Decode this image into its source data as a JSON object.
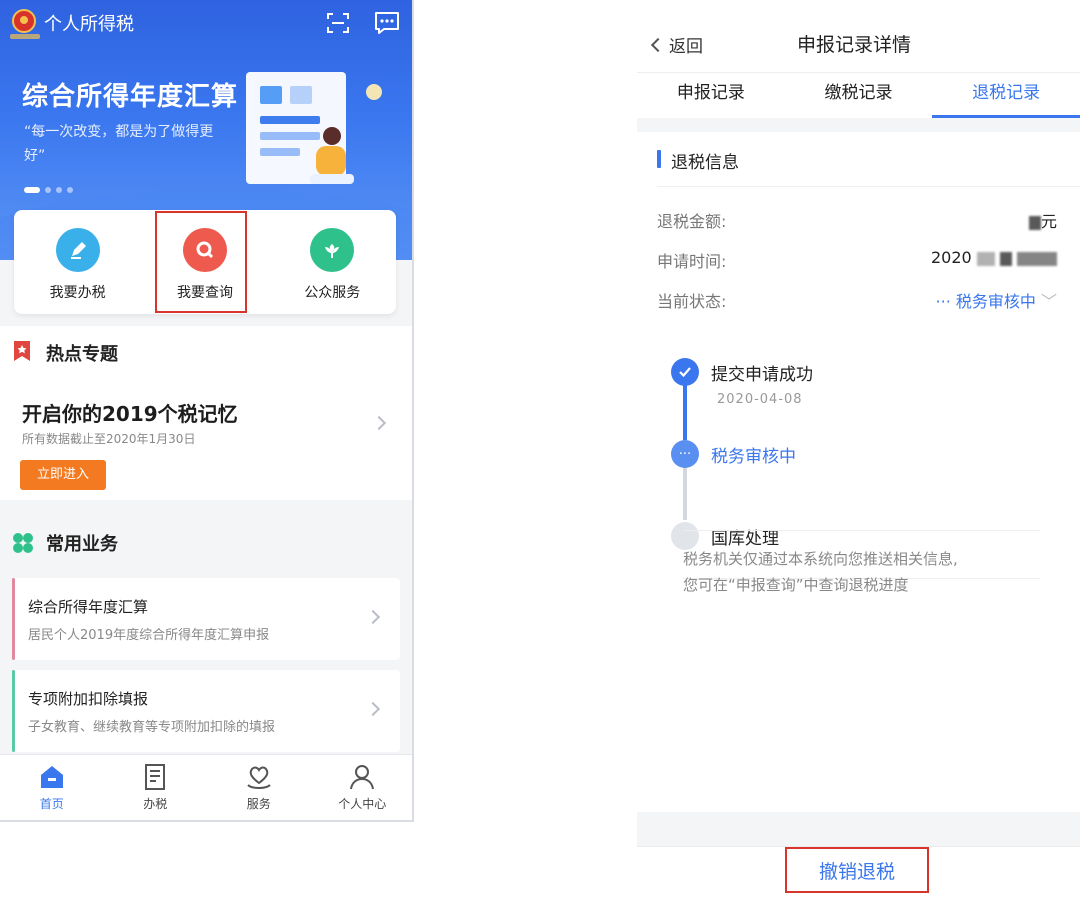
{
  "left": {
    "app_title": "个人所得税",
    "banner": {
      "title": "综合所得年度汇算",
      "subtitle": "“每一次改变，都是为了做得更好”"
    },
    "quick_actions": [
      {
        "label": "我要办税",
        "icon": "edit-icon",
        "color": "#3ab0ea"
      },
      {
        "label": "我要查询",
        "icon": "search-icon",
        "color": "#ee5a4d"
      },
      {
        "label": "公众服务",
        "icon": "flower-icon",
        "color": "#2fc18c"
      }
    ],
    "hot_topics": {
      "heading": "热点专题",
      "card_title": "开启你的2019个税记忆",
      "card_note": "所有数据截止至2020年1月30日",
      "button": "立即进入"
    },
    "common_business": {
      "heading": "常用业务",
      "items": [
        {
          "title": "综合所得年度汇算",
          "desc": "居民个人2019年度综合所得年度汇算申报",
          "accent": "#e08aa0"
        },
        {
          "title": "专项附加扣除填报",
          "desc": "子女教育、继续教育等专项附加扣除的填报",
          "accent": "#5cc9a6"
        }
      ]
    },
    "tabs": [
      {
        "label": "首页",
        "icon": "home-icon"
      },
      {
        "label": "办税",
        "icon": "document-icon"
      },
      {
        "label": "服务",
        "icon": "heart-hand-icon"
      },
      {
        "label": "个人中心",
        "icon": "user-icon"
      }
    ]
  },
  "right": {
    "back_label": "返回",
    "title": "申报记录详情",
    "tabs": [
      "申报记录",
      "缴税记录",
      "退税记录"
    ],
    "active_tab": "退税记录",
    "section_title": "退税信息",
    "fields": [
      {
        "label": "退税金额:",
        "value": "元"
      },
      {
        "label": "申请时间:",
        "value": "2020"
      },
      {
        "label": "当前状态:",
        "value": "··· 税务审核中"
      }
    ],
    "timeline": [
      {
        "label": "提交申请成功",
        "date": "2020-04-08",
        "state": "done"
      },
      {
        "label": "税务审核中",
        "date": "",
        "state": "current"
      },
      {
        "label": "国库处理",
        "date": "",
        "state": "pending"
      }
    ],
    "note_line1": "税务机关仅通过本系统向您推送相关信息,",
    "note_line2": "您可在“申报查询”中查询退税进度",
    "cancel_button": "撤销退税"
  },
  "colors": {
    "primary": "#3a77ef",
    "highlight": "#d7342c",
    "orange": "#f37a20"
  }
}
